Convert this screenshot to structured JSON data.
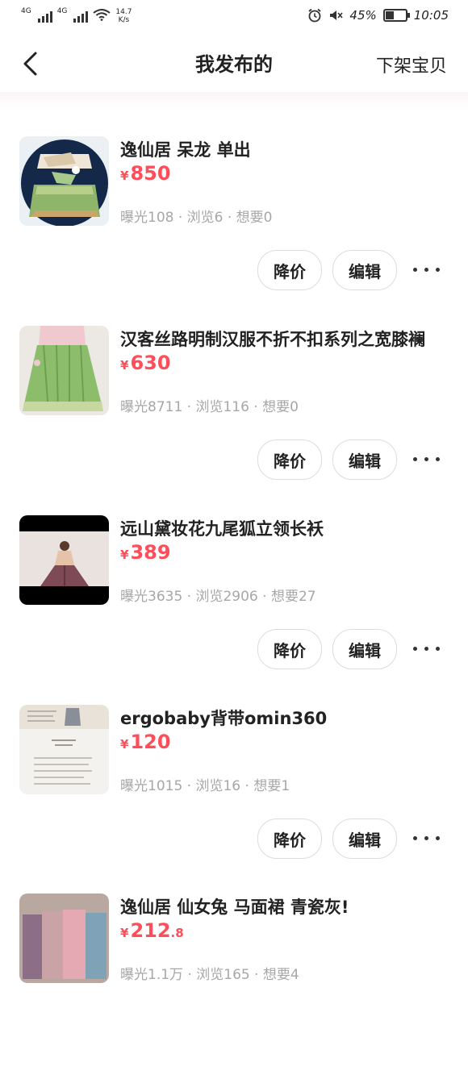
{
  "status_bar": {
    "sim1": "4G",
    "sim2": "4G",
    "net_speed": "14.7",
    "net_speed_unit": "K/s",
    "battery": "45%",
    "battery_level": 0.45,
    "time": "10:05",
    "icons": [
      "signal-icon",
      "wifi-icon",
      "alarm-icon",
      "mute-icon",
      "battery-icon"
    ]
  },
  "nav": {
    "title": "我发布的",
    "action": "下架宝贝",
    "back_icon": "chevron-left-icon"
  },
  "colors": {
    "price": "#ff4d5a",
    "stats": "#a7a7a7",
    "text": "#222222"
  },
  "items": [
    {
      "title": "逸仙居 呆龙 单出",
      "currency": "¥",
      "price": "850",
      "price_decimal": "",
      "stats": "曝光108 · 浏览6 · 想要0",
      "btn_reduce": "降价",
      "btn_edit": "编辑"
    },
    {
      "title": "汉客丝路明制汉服不折不扣系列之宽膝襕",
      "currency": "¥",
      "price": "630",
      "price_decimal": "",
      "stats": "曝光8711 · 浏览116 · 想要0",
      "btn_reduce": "降价",
      "btn_edit": "编辑"
    },
    {
      "title": "远山黛妆花九尾狐立领长袄",
      "currency": "¥",
      "price": "389",
      "price_decimal": "",
      "stats": "曝光3635 · 浏览2906 · 想要27",
      "btn_reduce": "降价",
      "btn_edit": "编辑"
    },
    {
      "title": "ergobaby背带omin360",
      "currency": "¥",
      "price": "120",
      "price_decimal": "",
      "stats": "曝光1015 · 浏览16 · 想要1",
      "btn_reduce": "降价",
      "btn_edit": "编辑"
    },
    {
      "title": "逸仙居 仙女兔 马面裙 青瓷灰!",
      "currency": "¥",
      "price": "212",
      "price_decimal": ".8",
      "stats": "曝光1.1万 · 浏览165 · 想要4",
      "btn_reduce": "降价",
      "btn_edit": "编辑"
    }
  ]
}
